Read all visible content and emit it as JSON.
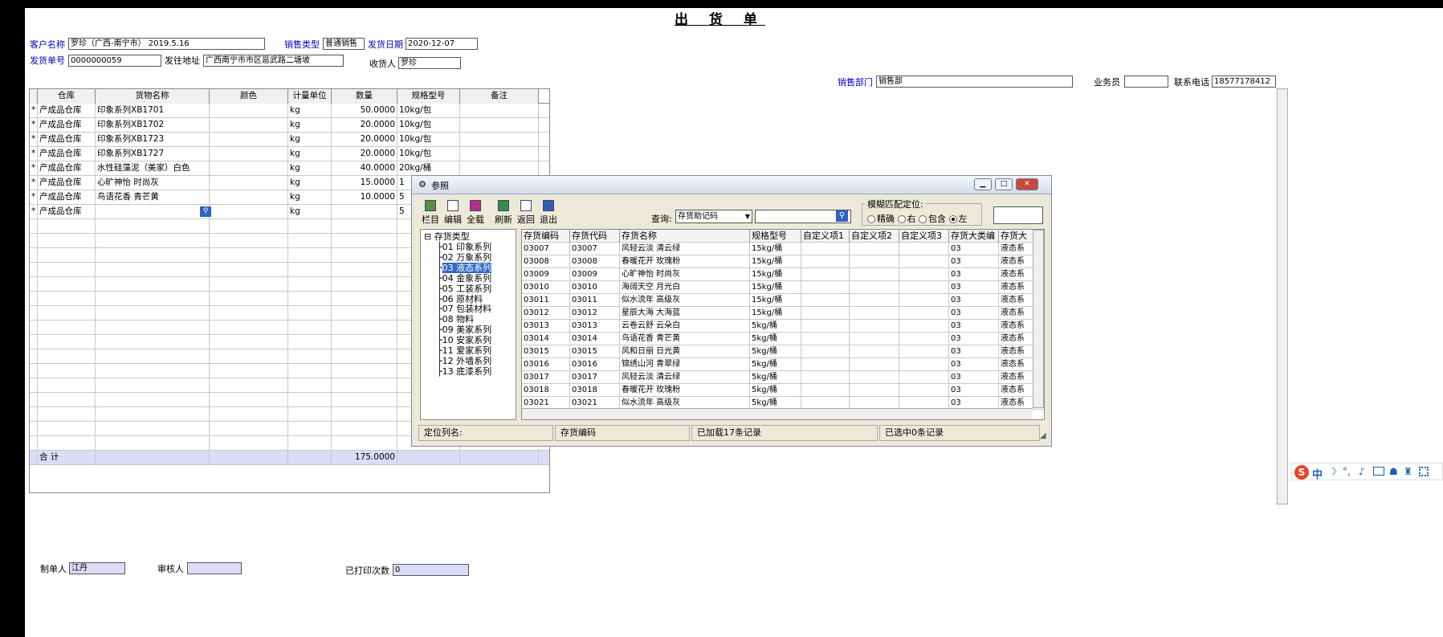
{
  "form": {
    "title": "出 货 单",
    "customer_label": "客户名称",
    "customer_value": "罗珍（广西-南宁市）    2019.5.16",
    "sales_type_label": "销售类型",
    "sales_type_value": "普通销售",
    "ship_date_label": "发货日期",
    "ship_date_value": "2020-12-07",
    "ship_no_label": "发货单号",
    "ship_no_value": "0000000059",
    "address_label": "发往地址",
    "address_value": "广西南宁市市区邕武路二塘坡",
    "receiver_label": "收货人",
    "receiver_value": "罗珍",
    "dept_label": "销售部门",
    "dept_value": "销售部",
    "clerk_label": "业务员",
    "clerk_value": "",
    "phone_label": "联系电话",
    "phone_value": "18577178412",
    "maker_label": "制单人",
    "maker_value": "江丹",
    "auditor_label": "审核人",
    "auditor_value": "",
    "printed_label": "已打印次数",
    "printed_value": "0"
  },
  "grid": {
    "headers": [
      "仓库",
      "货物名称",
      "颜色",
      "计量单位",
      "数量",
      "规格型号",
      "备注"
    ],
    "rows": [
      {
        "mark": "*",
        "warehouse": "产成品仓库",
        "name": "印象系列XB1701",
        "color": "",
        "unit": "kg",
        "qty": "50.0000",
        "spec": "10kg/包",
        "note": ""
      },
      {
        "mark": "*",
        "warehouse": "产成品仓库",
        "name": "印象系列XB1702",
        "color": "",
        "unit": "kg",
        "qty": "20.0000",
        "spec": "10kg/包",
        "note": ""
      },
      {
        "mark": "*",
        "warehouse": "产成品仓库",
        "name": "印象系列XB1723",
        "color": "",
        "unit": "kg",
        "qty": "20.0000",
        "spec": "10kg/包",
        "note": ""
      },
      {
        "mark": "*",
        "warehouse": "产成品仓库",
        "name": "印象系列XB1727",
        "color": "",
        "unit": "kg",
        "qty": "20.0000",
        "spec": "10kg/包",
        "note": ""
      },
      {
        "mark": "*",
        "warehouse": "产成品仓库",
        "name": "水性硅藻泥（美家）白色",
        "color": "",
        "unit": "kg",
        "qty": "40.0000",
        "spec": "20kg/桶",
        "note": ""
      },
      {
        "mark": "*",
        "warehouse": "产成品仓库",
        "name": "心旷神怡 时尚灰",
        "color": "",
        "unit": "kg",
        "qty": "15.0000",
        "spec": "1",
        "note": ""
      },
      {
        "mark": "*",
        "warehouse": "产成品仓库",
        "name": "鸟语花香 青芒黄",
        "color": "",
        "unit": "kg",
        "qty": "10.0000",
        "spec": "5",
        "note": ""
      },
      {
        "mark": "*",
        "warehouse": "产成品仓库",
        "name": "",
        "color": "",
        "unit": "kg",
        "qty": "",
        "spec": "5",
        "note": ""
      }
    ],
    "sum_label": "合  计",
    "sum_qty": "175.0000"
  },
  "dialog": {
    "title": "参照",
    "toolbar": [
      "栏目",
      "编辑",
      "全载",
      "刷新",
      "返回",
      "退出"
    ],
    "query_label": "查询:",
    "query_select": "存货助记码",
    "query_input": "",
    "fuzzy_label": "模糊匹配定位:",
    "fuzzy_options": [
      "精确",
      "右",
      "包含",
      "左"
    ],
    "fuzzy_selected": 3,
    "tree": {
      "root": "存货类型",
      "items": [
        "01 印象系列",
        "02 万象系列",
        "03 液态系列",
        "04 金象系列",
        "05 工装系列",
        "06 原材料",
        "07 包装材料",
        "08 物料",
        "09 美家系列",
        "10 安家系列",
        "11 爱家系列",
        "12 外墙系列",
        "13 底漆系列"
      ],
      "selected": 2
    },
    "columns": [
      "存货编码",
      "存货代码",
      "存货名称",
      "规格型号",
      "自定义项1",
      "自定义项2",
      "自定义项3",
      "存货大类编",
      "存货大"
    ],
    "rows": [
      [
        "03007",
        "03007",
        "风轻云淡 清云绿",
        "15kg/桶",
        "",
        "",
        "",
        "03",
        "液态系"
      ],
      [
        "03008",
        "03008",
        "春暖花开 玫瑰粉",
        "15kg/桶",
        "",
        "",
        "",
        "03",
        "液态系"
      ],
      [
        "03009",
        "03009",
        "心旷神怡 时尚灰",
        "15kg/桶",
        "",
        "",
        "",
        "03",
        "液态系"
      ],
      [
        "03010",
        "03010",
        "海阔天空 月光白",
        "15kg/桶",
        "",
        "",
        "",
        "03",
        "液态系"
      ],
      [
        "03011",
        "03011",
        "似水流年 高级灰",
        "15kg/桶",
        "",
        "",
        "",
        "03",
        "液态系"
      ],
      [
        "03012",
        "03012",
        "星辰大海 大海蓝",
        "15kg/桶",
        "",
        "",
        "",
        "03",
        "液态系"
      ],
      [
        "03013",
        "03013",
        "云卷云舒 云朵白",
        "5kg/桶",
        "",
        "",
        "",
        "03",
        "液态系"
      ],
      [
        "03014",
        "03014",
        "鸟语花香 青芒黄",
        "5kg/桶",
        "",
        "",
        "",
        "03",
        "液态系"
      ],
      [
        "03015",
        "03015",
        "风和日丽 日光黄",
        "5kg/桶",
        "",
        "",
        "",
        "03",
        "液态系"
      ],
      [
        "03016",
        "03016",
        "锦绣山河 青翠绿",
        "5kg/桶",
        "",
        "",
        "",
        "03",
        "液态系"
      ],
      [
        "03017",
        "03017",
        "风轻云淡 清云绿",
        "5kg/桶",
        "",
        "",
        "",
        "03",
        "液态系"
      ],
      [
        "03018",
        "03018",
        "春暖花开 玫瑰粉",
        "5kg/桶",
        "",
        "",
        "",
        "03",
        "液态系"
      ],
      [
        "03021",
        "03021",
        "似水流年 高级灰",
        "5kg/桶",
        "",
        "",
        "",
        "03",
        "液态系"
      ]
    ],
    "status_locate_label": "定位列名:",
    "status_locate_value": "存货编码",
    "status_loaded": "已加载17条记录",
    "status_selected": "已选中0条记录"
  },
  "ime_bar": {
    "items": [
      "中"
    ]
  }
}
